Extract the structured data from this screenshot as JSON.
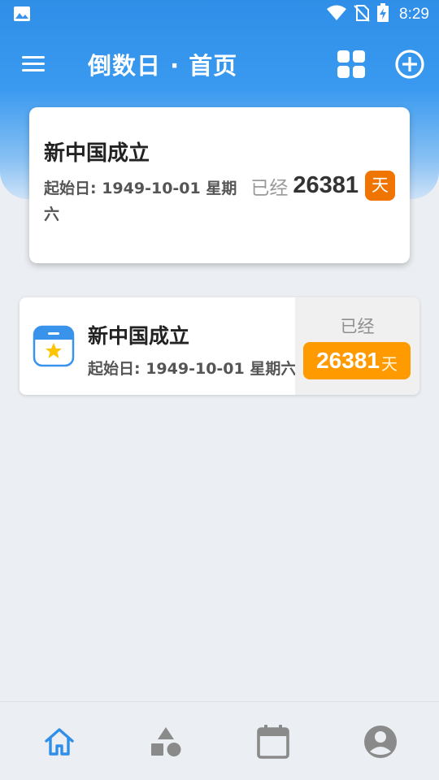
{
  "status_bar": {
    "time": "8:29",
    "icons": [
      "gallery-notification-icon",
      "wifi-icon",
      "no-sim-icon",
      "battery-charging-icon"
    ]
  },
  "app_bar": {
    "title": "倒数日 · 首页",
    "icons": [
      "menu-icon",
      "grid-view-icon",
      "add-circle-icon"
    ],
    "accent": "#2f8fe8"
  },
  "featured_event": {
    "title": "新中国成立",
    "date_line": "起始日: 1949-10-01 星期六",
    "prefix": "已经",
    "count": "26381",
    "unit": "天",
    "unit_color": "#f07500"
  },
  "events": [
    {
      "icon": "calendar-star-icon",
      "title": "新中国成立",
      "date_line": "起始日: 1949-10-01 星期六",
      "prefix": "已经",
      "count": "26381",
      "unit": "天",
      "badge_color": "#ff9a00"
    }
  ],
  "bottom_nav": {
    "items": [
      {
        "icon": "home-icon",
        "active": true
      },
      {
        "icon": "shapes-icon",
        "active": false
      },
      {
        "icon": "calendar-icon",
        "active": false
      },
      {
        "icon": "account-icon",
        "active": false
      }
    ],
    "active_color": "#2f8fe8",
    "inactive_color": "#8a8a8a"
  }
}
